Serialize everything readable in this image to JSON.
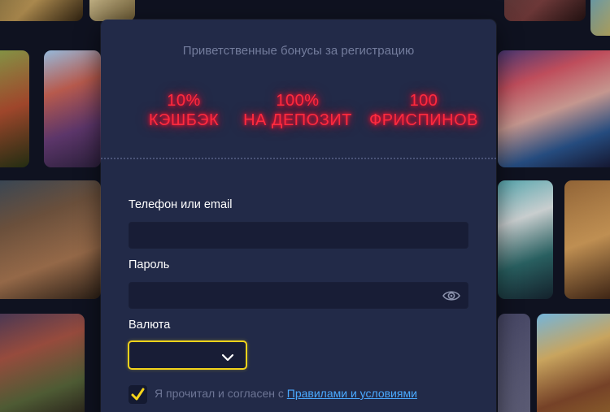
{
  "modal": {
    "title": "Приветственные бонусы за регистрацию",
    "bonuses": [
      {
        "line1": "10%",
        "line2": "КЭШБЭК"
      },
      {
        "line1": "100%",
        "line2": "НА ДЕПОЗИТ"
      },
      {
        "line1": "100",
        "line2": "ФРИСПИНОВ"
      }
    ],
    "neon_color": "#ff2b3f"
  },
  "form": {
    "login_label": "Телефон или email",
    "login_value": "",
    "password_label": "Пароль",
    "password_value": "",
    "currency_label": "Валюта",
    "currency_value": "",
    "terms_text": "Я прочитал и согласен с ",
    "terms_link": "Правилами и условиями",
    "terms_checked": true
  },
  "icons": {
    "password_toggle": "eye-icon",
    "currency_toggle": "chevron-down-icon",
    "checkbox_mark": "checkmark-icon"
  },
  "colors": {
    "modal_bg": "#222a48",
    "input_bg": "#181d36",
    "focus_border": "#f2d31b",
    "link": "#4aa9ff"
  }
}
